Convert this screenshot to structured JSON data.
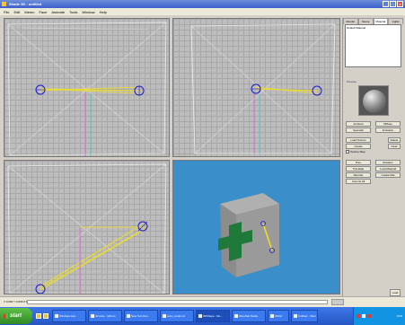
{
  "window": {
    "title": "Shade 3D - untitled"
  },
  "menu": {
    "items": [
      "File",
      "Edit",
      "Memo",
      "Face",
      "Animate",
      "Tools",
      "Window",
      "Help"
    ]
  },
  "right_panel": {
    "tabs": [
      "Render",
      "Scene",
      "Material",
      "Lights"
    ],
    "active_tab": 2,
    "material_list_item": "Default Material",
    "section_label": "Preview",
    "rows1": [
      [
        "Ambient",
        "Diffuse"
      ],
      [
        "Specular",
        "Emission"
      ]
    ],
    "rows2": [
      [
        "Load Texture",
        "Delete"
      ],
      [
        "Create",
        "Clear"
      ]
    ],
    "checkbox_label": "Texture Map",
    "rows3": [
      [
        "Prev",
        "Rotation"
      ],
      [
        "Translate",
        "Load Material"
      ],
      [
        "Reorder",
        "Create Mat"
      ],
      [
        "Commit All",
        ""
      ]
    ],
    "load_btn": "Load"
  },
  "status": {
    "coords": "X 0.000  Y 0.000  Z 1.000"
  },
  "taskbar": {
    "start": "start",
    "buttons": [
      "Windows Exp...",
      "3d cube - Mirrors",
      "New Text Doc...",
      "cube_sculpt.txt",
      "3DShape - Mo...",
      "Woodhat Studio",
      "3DCA",
      "Untitled - Paint"
    ],
    "active": 4,
    "clock": "8:06"
  },
  "colors": {
    "viewport_blue": "#3a8ec9",
    "cube_face": "#9a9a9a",
    "cross": "#1f7a3a",
    "wire_yellow": "#f0e020"
  }
}
